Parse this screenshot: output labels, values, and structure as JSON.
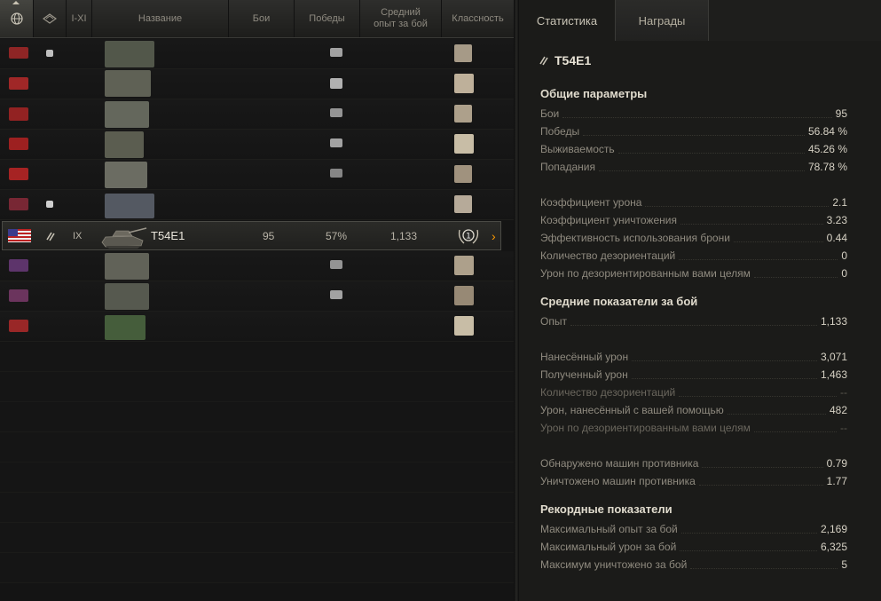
{
  "columns": {
    "nation_icon": "globe-icon",
    "type_icon": "tank-type-icon",
    "tier": "I-XI",
    "name": "Название",
    "battles": "Бои",
    "wins": "Победы",
    "avg_xp": "Средний опыт за бой",
    "mastery": "Классность"
  },
  "selected_row": {
    "flag": "usa-flag-icon",
    "type_icon": "medium-tank-icon",
    "tier": "IX",
    "name": "T54E1",
    "battles": "95",
    "wins": "57%",
    "avg_xp": "1,133",
    "mastery": "1",
    "arrow": "›"
  },
  "tabs": [
    {
      "label": "Статистика",
      "active": true
    },
    {
      "label": "Награды",
      "active": false
    }
  ],
  "vehicle": {
    "name": "T54E1"
  },
  "general": {
    "title": "Общие параметры",
    "stats": [
      {
        "label": "Бои",
        "value": "95"
      },
      {
        "label": "Победы",
        "value": "56.84 %"
      },
      {
        "label": "Выживаемость",
        "value": "45.26 %"
      },
      {
        "label": "Попадания",
        "value": "78.78 %"
      },
      {
        "label": "Коэффициент урона",
        "value": "2.1"
      },
      {
        "label": "Коэффициент уничтожения",
        "value": "3.23"
      },
      {
        "label": "Эффективность использования брони",
        "value": "0.44"
      },
      {
        "label": "Количество дезориентаций",
        "value": "0"
      },
      {
        "label": "Урон по дезориентированным вами целям",
        "value": "0"
      }
    ]
  },
  "average": {
    "title": "Средние показатели за бой",
    "stats": [
      {
        "label": "Опыт",
        "value": "1,133"
      },
      {
        "label": "Нанесённый урон",
        "value": "3,071"
      },
      {
        "label": "Полученный урон",
        "value": "1,463"
      },
      {
        "label": "Количество дезориентаций",
        "value": "--"
      },
      {
        "label": "Урон, нанесённый с вашей помощью",
        "value": "482"
      },
      {
        "label": "Урон по дезориентированным вами целям",
        "value": "--"
      },
      {
        "label": "Обнаружено машин противника",
        "value": "0.79"
      },
      {
        "label": "Уничтожено машин противника",
        "value": "1.77"
      }
    ]
  },
  "records": {
    "title": "Рекордные показатели",
    "stats": [
      {
        "label": "Максимальный опыт за бой",
        "value": "2,169"
      },
      {
        "label": "Максимальный урон за бой",
        "value": "6,325"
      },
      {
        "label": "Максимум уничтожено за бой",
        "value": "5"
      }
    ]
  },
  "colors": {
    "accent": "#ff9b00",
    "panel": "#1b1b19"
  }
}
